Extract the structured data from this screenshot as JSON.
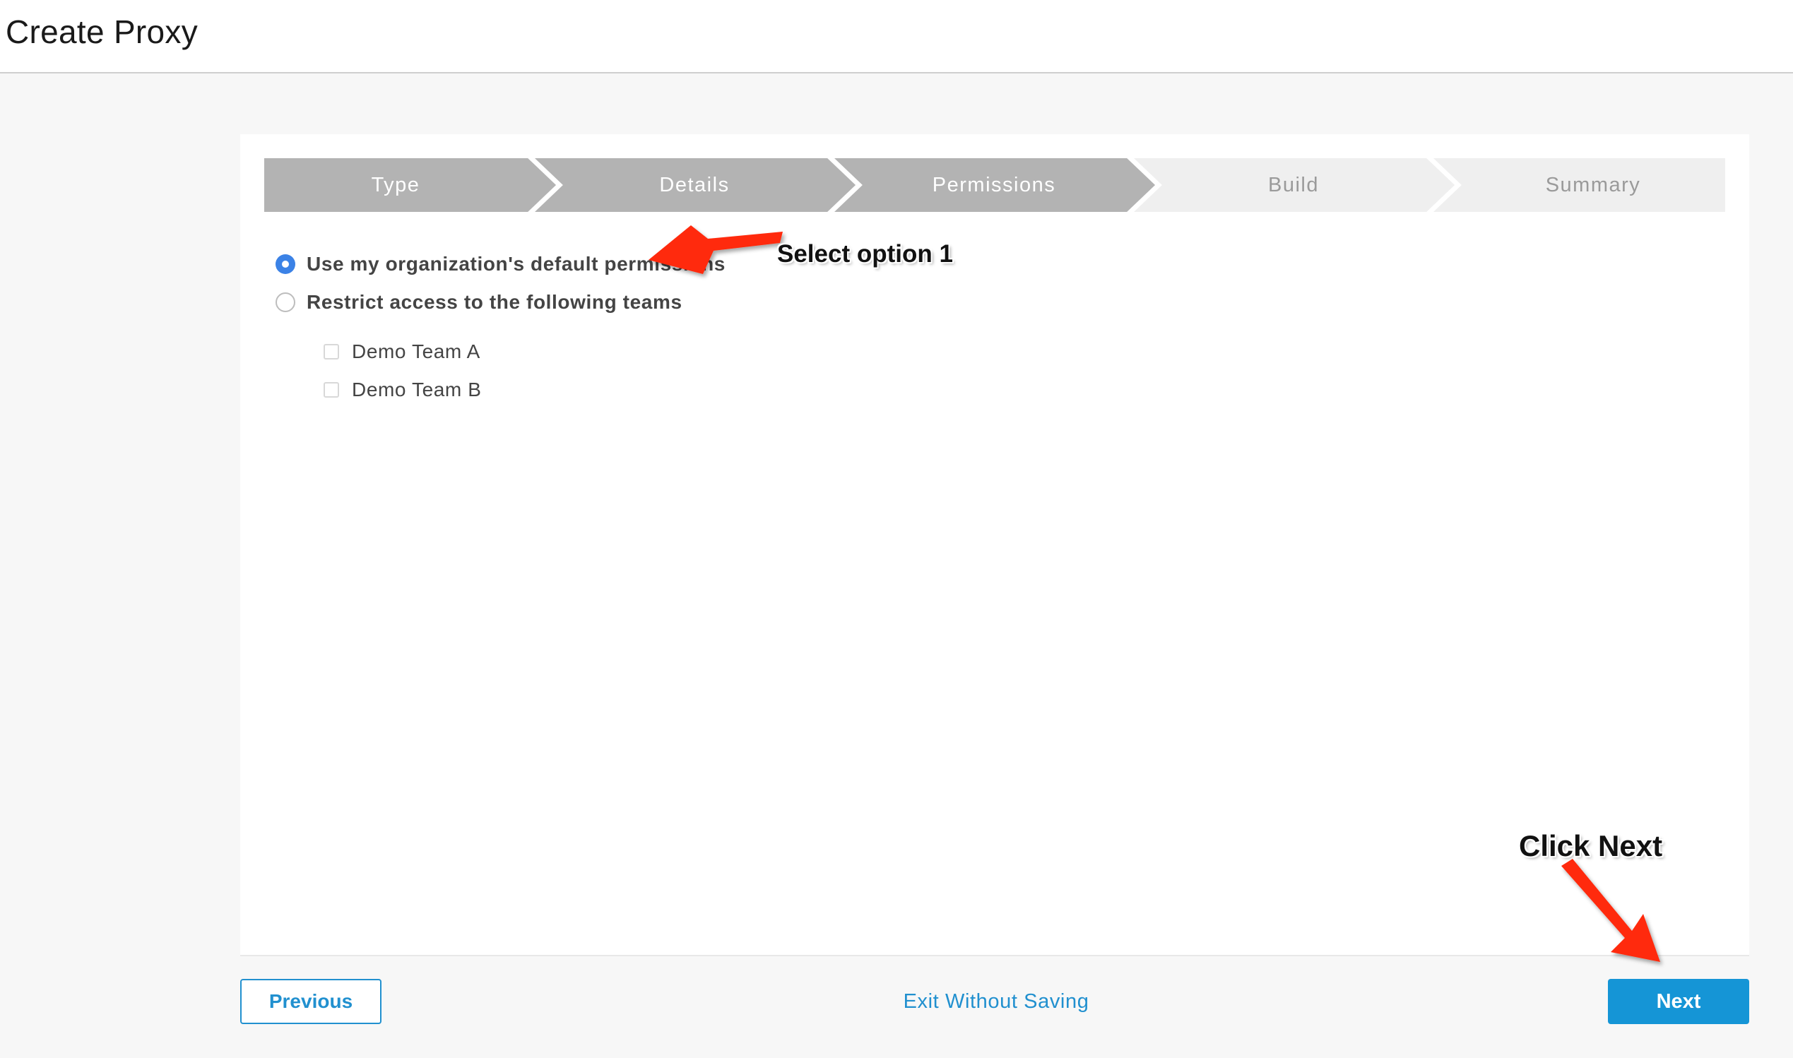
{
  "page": {
    "title": "Create Proxy"
  },
  "wizard": {
    "steps": [
      {
        "label": "Type",
        "state": "completed"
      },
      {
        "label": "Details",
        "state": "completed"
      },
      {
        "label": "Permissions",
        "state": "current"
      },
      {
        "label": "Build",
        "state": "upcoming"
      },
      {
        "label": "Summary",
        "state": "upcoming"
      }
    ]
  },
  "permissions": {
    "options": [
      {
        "label": "Use my organization's default permissions",
        "selected": true
      },
      {
        "label": "Restrict access to the following teams",
        "selected": false
      }
    ],
    "teams": [
      {
        "label": "Demo Team A",
        "checked": false
      },
      {
        "label": "Demo Team B",
        "checked": false
      }
    ]
  },
  "footer": {
    "previous_label": "Previous",
    "exit_label": "Exit Without Saving",
    "next_label": "Next"
  },
  "annotations": {
    "select_option": "Select option 1",
    "click_next": "Click Next",
    "arrow_color": "#ff2a0a"
  },
  "colors": {
    "accent": "#2190cf",
    "radio_selected": "#3b82e6",
    "step_active": "#b3b3b3",
    "step_inactive": "#efefef"
  }
}
